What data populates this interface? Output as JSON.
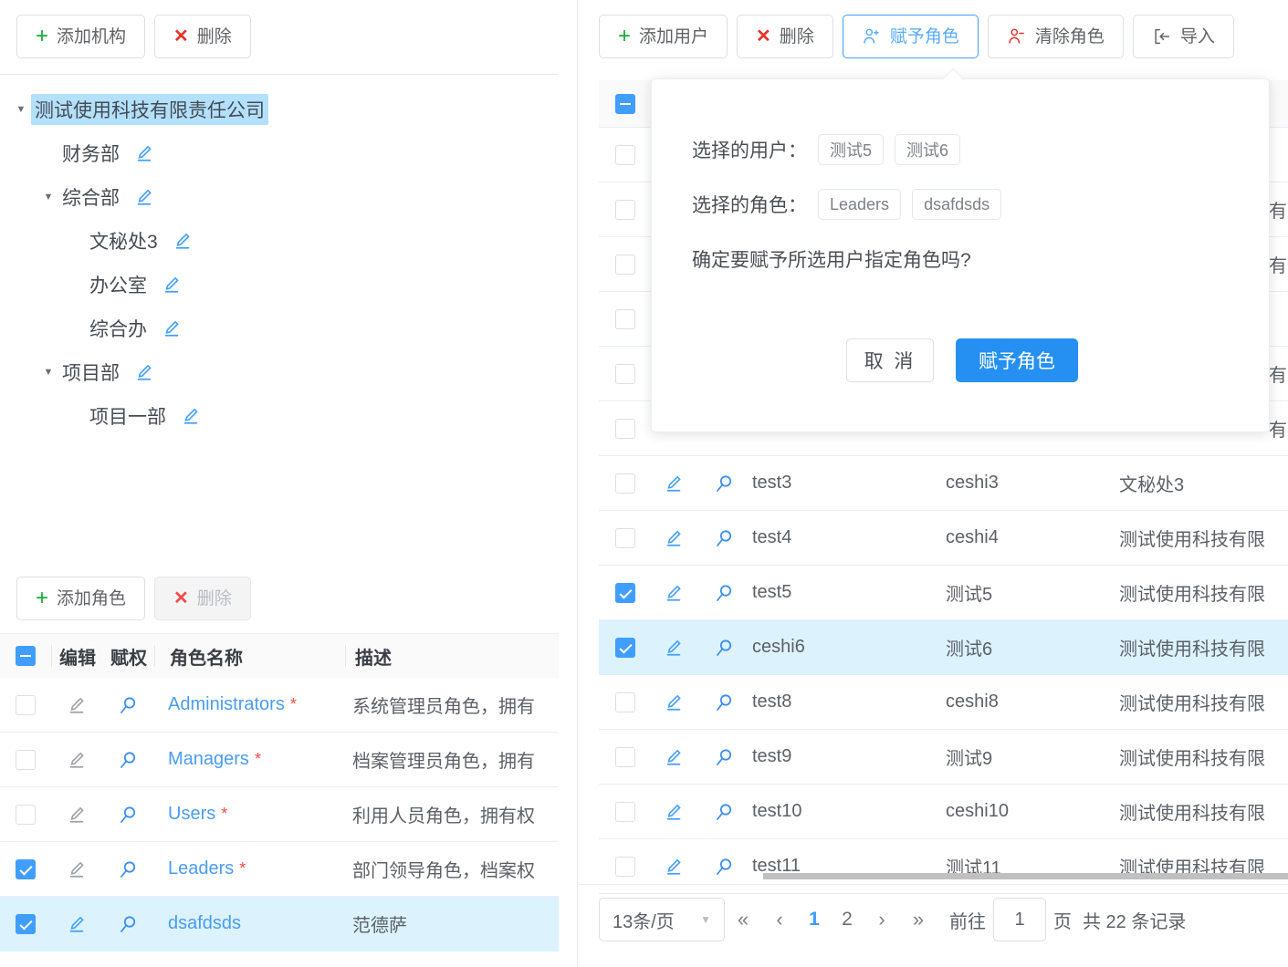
{
  "org_panel": {
    "toolbar": {
      "add_label": "添加机构",
      "add_icon": "plus-icon",
      "delete_label": "删除",
      "delete_icon": "cross-icon"
    },
    "tree": [
      {
        "label": "测试使用科技有限责任公司",
        "depth": 0,
        "caret": "▼",
        "selected": true,
        "edit": false
      },
      {
        "label": "财务部",
        "depth": 1,
        "caret": "",
        "selected": false,
        "edit": true
      },
      {
        "label": "综合部",
        "depth": 1,
        "caret": "▼",
        "selected": false,
        "edit": true
      },
      {
        "label": "文秘处3",
        "depth": 2,
        "caret": "",
        "selected": false,
        "edit": true
      },
      {
        "label": "办公室",
        "depth": 2,
        "caret": "",
        "selected": false,
        "edit": true
      },
      {
        "label": "综合办",
        "depth": 2,
        "caret": "",
        "selected": false,
        "edit": true
      },
      {
        "label": "项目部",
        "depth": 1,
        "caret": "▼",
        "selected": false,
        "edit": true
      },
      {
        "label": "项目一部",
        "depth": 2,
        "caret": "",
        "selected": false,
        "edit": true
      }
    ]
  },
  "role_panel": {
    "toolbar": {
      "add_label": "添加角色",
      "add_icon": "plus-icon",
      "delete_label": "删除",
      "delete_icon": "cross-icon",
      "delete_disabled": true
    },
    "columns": {
      "select_all": "indeterminate",
      "edit": "编辑",
      "auth": "赋权",
      "name": "角色名称",
      "desc": "描述"
    },
    "rows": [
      {
        "checked": false,
        "name": "Administrators",
        "required": "*",
        "desc": "系统管理员角色，拥有"
      },
      {
        "checked": false,
        "name": "Managers",
        "required": "*",
        "desc": "档案管理员角色，拥有"
      },
      {
        "checked": false,
        "name": "Users",
        "required": "*",
        "desc": "利用人员角色，拥有权"
      },
      {
        "checked": true,
        "name": "Leaders",
        "required": "*",
        "desc": "部门领导角色，档案权"
      },
      {
        "checked": true,
        "name": "dsafdsds",
        "required": "",
        "desc": "范德萨"
      }
    ]
  },
  "user_panel": {
    "toolbar": [
      {
        "label": "添加用户",
        "icon": "plus-icon",
        "state": "normal"
      },
      {
        "label": "删除",
        "icon": "cross-icon",
        "state": "normal"
      },
      {
        "label": "赋予角色",
        "icon": "user-add-icon",
        "state": "active"
      },
      {
        "label": "清除角色",
        "icon": "user-remove-icon",
        "state": "normal"
      },
      {
        "label": "导入",
        "icon": "import-icon",
        "state": "normal"
      }
    ],
    "header": {
      "select_all": "indeterminate"
    },
    "rows": [
      {
        "checked": false,
        "account": "",
        "name": "",
        "org": "",
        "clip": ""
      },
      {
        "checked": false,
        "account": "",
        "name": "",
        "org": "",
        "clip": "有"
      },
      {
        "checked": false,
        "account": "",
        "name": "",
        "org": "",
        "clip": "有"
      },
      {
        "checked": false,
        "account": "",
        "name": "",
        "org": "",
        "clip": ""
      },
      {
        "checked": false,
        "account": "",
        "name": "",
        "org": "",
        "clip": "有"
      },
      {
        "checked": false,
        "account": "",
        "name": "",
        "org": "",
        "clip": "有"
      },
      {
        "checked": false,
        "account": "test3",
        "name": "ceshi3",
        "org": "文秘处3",
        "clip": ""
      },
      {
        "checked": false,
        "account": "test4",
        "name": "ceshi4",
        "org": "测试使用科技有限",
        "clip": ""
      },
      {
        "checked": true,
        "account": "test5",
        "name": "测试5",
        "org": "测试使用科技有限",
        "clip": ""
      },
      {
        "checked": true,
        "account": "ceshi6",
        "name": "测试6",
        "org": "测试使用科技有限",
        "clip": "",
        "highlight": true
      },
      {
        "checked": false,
        "account": "test8",
        "name": "ceshi8",
        "org": "测试使用科技有限",
        "clip": ""
      },
      {
        "checked": false,
        "account": "test9",
        "name": "测试9",
        "org": "测试使用科技有限",
        "clip": ""
      },
      {
        "checked": false,
        "account": "test10",
        "name": "ceshi10",
        "org": "测试使用科技有限",
        "clip": ""
      },
      {
        "checked": false,
        "account": "test11",
        "name": "测试11",
        "org": "测试使用科技有限",
        "clip": ""
      }
    ],
    "pagination": {
      "page_size_label": "13条/页",
      "first_icon": "«",
      "prev_icon": "‹",
      "pages": [
        "1",
        "2"
      ],
      "current_page": "1",
      "next_icon": "›",
      "last_icon": "»",
      "goto_label": "前往",
      "goto_value": "1",
      "goto_suffix": "页",
      "total_text": "共 22 条记录"
    }
  },
  "popover": {
    "users_label": "选择的用户：",
    "users": [
      "测试5",
      "测试6"
    ],
    "roles_label": "选择的角色：",
    "roles": [
      "Leaders",
      "dsafdsds"
    ],
    "question": "确定要赋予所选用户指定角色吗?",
    "cancel_label": "取 消",
    "confirm_label": "赋予角色"
  },
  "colors": {
    "accent": "#409eff",
    "confirm_button": "#2590f2",
    "selected_row": "#dcf2fd",
    "tree_selected": "#b3e0fb",
    "danger": "#e8322c",
    "success": "#13ad36",
    "link": "#4a9cf0"
  }
}
